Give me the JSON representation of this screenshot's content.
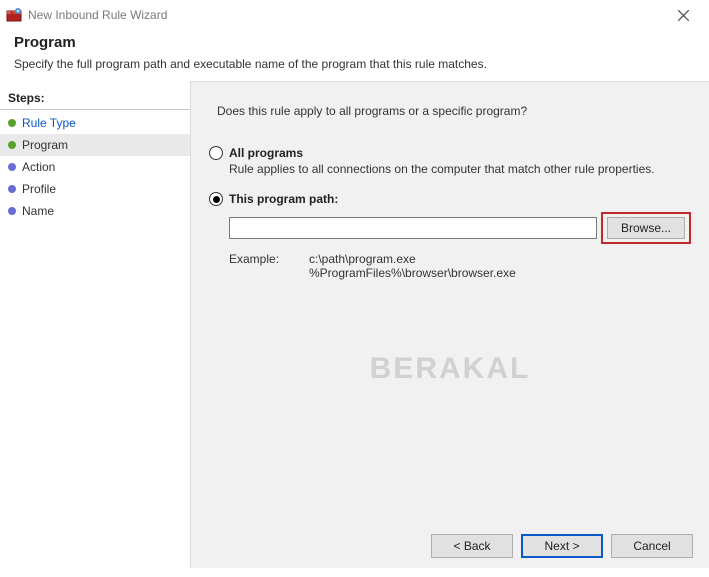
{
  "window": {
    "title": "New Inbound Rule Wizard"
  },
  "header": {
    "title": "Program",
    "description": "Specify the full program path and executable name of the program that this rule matches."
  },
  "sidebar": {
    "heading": "Steps:",
    "items": [
      {
        "label": "Rule Type"
      },
      {
        "label": "Program"
      },
      {
        "label": "Action"
      },
      {
        "label": "Profile"
      },
      {
        "label": "Name"
      }
    ]
  },
  "content": {
    "question": "Does this rule apply to all programs or a specific program?",
    "options": {
      "all": {
        "label": "All programs",
        "description": "Rule applies to all connections on the computer that match other rule properties.",
        "selected": false
      },
      "path": {
        "label": "This program path:",
        "selected": true,
        "input_value": "",
        "browse_label": "Browse...",
        "example_label": "Example:",
        "example_line1": "c:\\path\\program.exe",
        "example_line2": "%ProgramFiles%\\browser\\browser.exe"
      }
    }
  },
  "footer": {
    "back": "< Back",
    "next": "Next >",
    "cancel": "Cancel"
  },
  "watermark": "BERAKAL"
}
